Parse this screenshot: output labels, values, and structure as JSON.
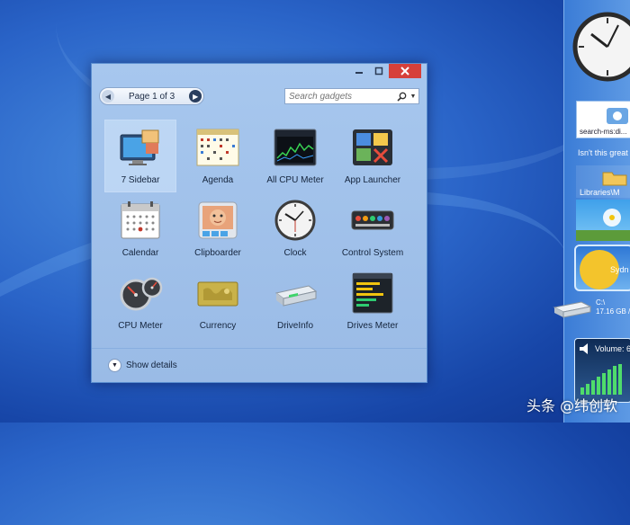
{
  "window": {
    "pager_label": "Page 1 of 3",
    "search_placeholder": "Search gadgets",
    "footer_label": "Show details"
  },
  "gadgets": [
    {
      "label": "7 Sidebar",
      "icon": "sidebar-monitor-icon",
      "selected": true
    },
    {
      "label": "Agenda",
      "icon": "agenda-calendar-icon"
    },
    {
      "label": "All CPU Meter",
      "icon": "cpu-graph-icon"
    },
    {
      "label": "App Launcher",
      "icon": "app-launcher-icon"
    },
    {
      "label": "Calendar",
      "icon": "calendar-icon"
    },
    {
      "label": "Clipboarder",
      "icon": "clipboard-photo-icon"
    },
    {
      "label": "Clock",
      "icon": "clock-icon"
    },
    {
      "label": "Control System",
      "icon": "control-panel-icon"
    },
    {
      "label": "CPU Meter",
      "icon": "gauge-meter-icon"
    },
    {
      "label": "Currency",
      "icon": "currency-map-icon"
    },
    {
      "label": "DriveInfo",
      "icon": "hard-drive-icon"
    },
    {
      "label": "Drives Meter",
      "icon": "drives-meter-icon"
    }
  ],
  "sidebar": {
    "search_query": "search-ms:di...",
    "text_line": "Isn't this great",
    "libraries_label": "Libraries\\M",
    "weather_city": "Sydn",
    "drive_line1": "C:\\",
    "drive_line2": "17.16 GB /",
    "volume_label": "Volume: 6"
  },
  "watermark": "头条 @纬创软"
}
